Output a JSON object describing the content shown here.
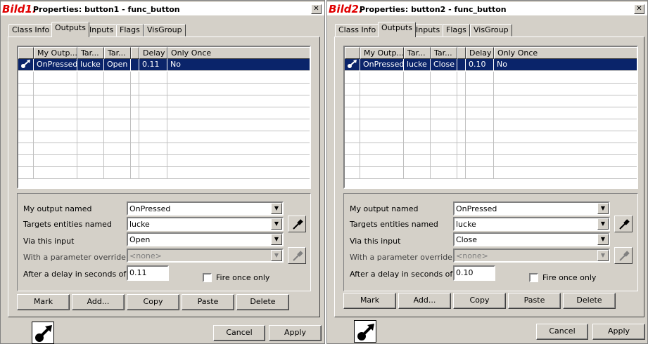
{
  "windows": [
    {
      "label": "Bild1:",
      "title": "Properties: button1 - func_button",
      "close": "✕",
      "tabs": [
        "Class Info",
        "Outputs",
        "Inputs",
        "Flags",
        "VisGroup"
      ],
      "active_tab": "Outputs",
      "columns": [
        "My Outp...",
        "Tar...",
        "Tar...",
        "Delay",
        "Only Once"
      ],
      "rows": [
        {
          "output": "OnPressed",
          "target": "lucke",
          "input": "Open",
          "delay": "0.11",
          "once": "No"
        }
      ],
      "labels": {
        "output_named": "My output named",
        "targets": "Targets entities named",
        "via_input": "Via this input",
        "param": "With a parameter override of",
        "delay": "After a delay in seconds of",
        "fire_once": "Fire once only"
      },
      "values": {
        "output_named": "OnPressed",
        "targets": "lucke",
        "via_input": "Open",
        "param": "<none>",
        "delay": "0.11"
      },
      "fire_once_checked": false,
      "buttons": [
        "Mark",
        "Add...",
        "Copy",
        "Paste",
        "Delete"
      ],
      "footer": {
        "cancel": "Cancel",
        "apply": "Apply"
      }
    },
    {
      "label": "Bild2:",
      "title": "Properties: button2 - func_button",
      "close": "✕",
      "tabs": [
        "Class Info",
        "Outputs",
        "Inputs",
        "Flags",
        "VisGroup"
      ],
      "active_tab": "Outputs",
      "columns": [
        "My Outp...",
        "Tar...",
        "Tar...",
        "Delay",
        "Only Once"
      ],
      "rows": [
        {
          "output": "OnPressed",
          "target": "lucke",
          "input": "Close",
          "delay": "0.10",
          "once": "No"
        }
      ],
      "labels": {
        "output_named": "My output named",
        "targets": "Targets entities named",
        "via_input": "Via this input",
        "param": "With a parameter override of",
        "delay": "After a delay in seconds of",
        "fire_once": "Fire once only"
      },
      "values": {
        "output_named": "OnPressed",
        "targets": "lucke",
        "via_input": "Close",
        "param": "<none>",
        "delay": "0.10"
      },
      "fire_once_checked": false,
      "buttons": [
        "Mark",
        "Add...",
        "Copy",
        "Paste",
        "Delete"
      ],
      "footer": {
        "cancel": "Cancel",
        "apply": "Apply"
      }
    }
  ],
  "colors": {
    "selection": "#0a246a",
    "label_red": "#e00000",
    "dialog_bg": "#d4d0c8"
  },
  "icons": {
    "output_row": "output-arrow-icon",
    "picker": "eyedropper-icon",
    "entity": "entity-output-icon"
  }
}
